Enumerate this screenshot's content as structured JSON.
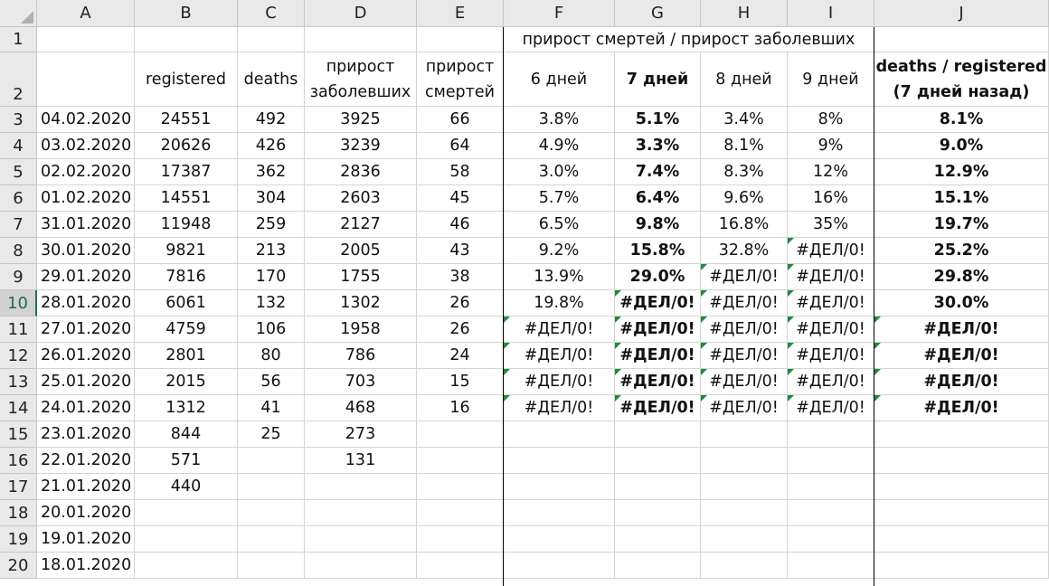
{
  "columns": [
    "A",
    "B",
    "C",
    "D",
    "E",
    "F",
    "G",
    "H",
    "I",
    "J"
  ],
  "row_numbers": [
    "1",
    "2",
    "3",
    "4",
    "5",
    "6",
    "7",
    "8",
    "9",
    "10",
    "11",
    "12",
    "13",
    "14",
    "15",
    "16",
    "17",
    "18",
    "19",
    "20"
  ],
  "selected_row": "10",
  "row1": {
    "merged_title": "прирост смертей / прирост заболевших"
  },
  "row2": {
    "B": "registered",
    "C": "deaths",
    "D_line1": "прирост",
    "D_line2": "заболевших",
    "E_line1": "прирост",
    "E_line2": "смертей",
    "F": "6 дней",
    "G": "7 дней",
    "H": "8 дней",
    "I": "9 дней",
    "J_line1": "deaths / registered",
    "J_line2": "(7 дней назад)"
  },
  "rows": [
    {
      "A": "04.02.2020",
      "B": "24551",
      "C": "492",
      "D": "3925",
      "E": "66",
      "F": "3.8%",
      "G": "5.1%",
      "H": "3.4%",
      "I": "8%",
      "J": "8.1%"
    },
    {
      "A": "03.02.2020",
      "B": "20626",
      "C": "426",
      "D": "3239",
      "E": "64",
      "F": "4.9%",
      "G": "3.3%",
      "H": "8.1%",
      "I": "9%",
      "J": "9.0%"
    },
    {
      "A": "02.02.2020",
      "B": "17387",
      "C": "362",
      "D": "2836",
      "E": "58",
      "F": "3.0%",
      "G": "7.4%",
      "H": "8.3%",
      "I": "12%",
      "J": "12.9%"
    },
    {
      "A": "01.02.2020",
      "B": "14551",
      "C": "304",
      "D": "2603",
      "E": "45",
      "F": "5.7%",
      "G": "6.4%",
      "H": "9.6%",
      "I": "16%",
      "J": "15.1%"
    },
    {
      "A": "31.01.2020",
      "B": "11948",
      "C": "259",
      "D": "2127",
      "E": "46",
      "F": "6.5%",
      "G": "9.8%",
      "H": "16.8%",
      "I": "35%",
      "J": "19.7%"
    },
    {
      "A": "30.01.2020",
      "B": "9821",
      "C": "213",
      "D": "2005",
      "E": "43",
      "F": "9.2%",
      "G": "15.8%",
      "H": "32.8%",
      "I": "#ДЕЛ/0!",
      "J": "25.2%"
    },
    {
      "A": "29.01.2020",
      "B": "7816",
      "C": "170",
      "D": "1755",
      "E": "38",
      "F": "13.9%",
      "G": "29.0%",
      "H": "#ДЕЛ/0!",
      "I": "#ДЕЛ/0!",
      "J": "29.8%"
    },
    {
      "A": "28.01.2020",
      "B": "6061",
      "C": "132",
      "D": "1302",
      "E": "26",
      "F": "19.8%",
      "G": "#ДЕЛ/0!",
      "H": "#ДЕЛ/0!",
      "I": "#ДЕЛ/0!",
      "J": "30.0%"
    },
    {
      "A": "27.01.2020",
      "B": "4759",
      "C": "106",
      "D": "1958",
      "E": "26",
      "F": "#ДЕЛ/0!",
      "G": "#ДЕЛ/0!",
      "H": "#ДЕЛ/0!",
      "I": "#ДЕЛ/0!",
      "J": "#ДЕЛ/0!"
    },
    {
      "A": "26.01.2020",
      "B": "2801",
      "C": "80",
      "D": "786",
      "E": "24",
      "F": "#ДЕЛ/0!",
      "G": "#ДЕЛ/0!",
      "H": "#ДЕЛ/0!",
      "I": "#ДЕЛ/0!",
      "J": "#ДЕЛ/0!"
    },
    {
      "A": "25.01.2020",
      "B": "2015",
      "C": "56",
      "D": "703",
      "E": "15",
      "F": "#ДЕЛ/0!",
      "G": "#ДЕЛ/0!",
      "H": "#ДЕЛ/0!",
      "I": "#ДЕЛ/0!",
      "J": "#ДЕЛ/0!"
    },
    {
      "A": "24.01.2020",
      "B": "1312",
      "C": "41",
      "D": "468",
      "E": "16",
      "F": "#ДЕЛ/0!",
      "G": "#ДЕЛ/0!",
      "H": "#ДЕЛ/0!",
      "I": "#ДЕЛ/0!",
      "J": "#ДЕЛ/0!"
    },
    {
      "A": "23.01.2020",
      "B": "844",
      "C": "25",
      "D": "273",
      "E": "",
      "F": "",
      "G": "",
      "H": "",
      "I": "",
      "J": ""
    },
    {
      "A": "22.01.2020",
      "B": "571",
      "C": "",
      "D": "131",
      "E": "",
      "F": "",
      "G": "",
      "H": "",
      "I": "",
      "J": ""
    },
    {
      "A": "21.01.2020",
      "B": "440",
      "C": "",
      "D": "",
      "E": "",
      "F": "",
      "G": "",
      "H": "",
      "I": "",
      "J": ""
    },
    {
      "A": "20.01.2020",
      "B": "",
      "C": "",
      "D": "",
      "E": "",
      "F": "",
      "G": "",
      "H": "",
      "I": "",
      "J": ""
    },
    {
      "A": "19.01.2020",
      "B": "",
      "C": "",
      "D": "",
      "E": "",
      "F": "",
      "G": "",
      "H": "",
      "I": "",
      "J": ""
    },
    {
      "A": "18.01.2020",
      "B": "",
      "C": "",
      "D": "",
      "E": "",
      "F": "",
      "G": "",
      "H": "",
      "I": "",
      "J": ""
    }
  ],
  "colors": {
    "header_bg": "#e9e9e9",
    "grid": "#d4d4d4",
    "error_indicator": "#1e8a3c",
    "selected_row_text": "#1f6e43"
  }
}
